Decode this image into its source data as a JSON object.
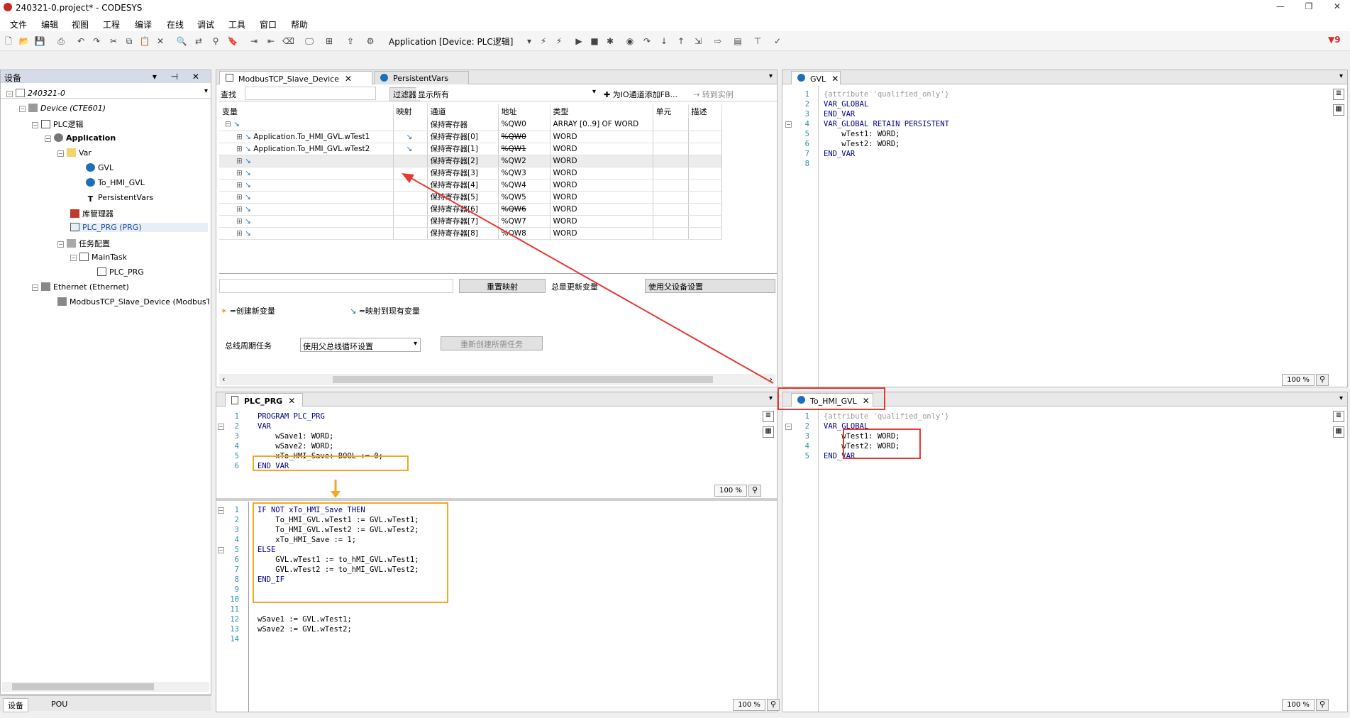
{
  "title": "240321-0.project* - CODESYS",
  "error_count": "9",
  "menu": [
    "文件",
    "编辑",
    "视图",
    "工程",
    "编译",
    "在线",
    "调试",
    "工具",
    "窗口",
    "帮助"
  ],
  "toolbar": {
    "app_selector": "Application [Device: PLC逻辑]"
  },
  "device_panel": {
    "title": "设备",
    "bottom_tabs": [
      "设备",
      "POU"
    ],
    "tree": [
      "240321-0",
      "Device (CTE601)",
      "PLC逻辑",
      "Application",
      "Var",
      "GVL",
      "To_HMI_GVL",
      "PersistentVars",
      "库管理器",
      "PLC_PRG (PRG)",
      "任务配置",
      "MainTask",
      "PLC_PRG",
      "Ethernet (Ethernet)",
      "ModbusTCP_Slave_Device (ModbusTCP S"
    ]
  },
  "top_editor": {
    "tabs": [
      "ModbusTCP_Slave_Device",
      "PersistentVars"
    ],
    "search_label": "查找",
    "filter_label": "过滤器",
    "filter_value": "显示所有",
    "add_fb_label": "为IO通道添加FB...",
    "goto_instance_label": "转到实例",
    "columns": [
      "变量",
      "映射",
      "通道",
      "地址",
      "类型",
      "单元",
      "描述"
    ],
    "rows": [
      {
        "var": "",
        "channel": "保持寄存器",
        "addr": "%QW0",
        "type": "ARRAY [0..9] OF WORD"
      },
      {
        "var": "Application.To_HMI_GVL.wTest1",
        "channel": "保持寄存器[0]",
        "addr": "%QW0",
        "type": "WORD"
      },
      {
        "var": "Application.To_HMI_GVL.wTest2",
        "channel": "保持寄存器[1]",
        "addr": "%QW1",
        "type": "WORD"
      },
      {
        "var": "",
        "channel": "保持寄存器[2]",
        "addr": "%QW2",
        "type": "WORD"
      },
      {
        "var": "",
        "channel": "保持寄存器[3]",
        "addr": "%QW3",
        "type": "WORD"
      },
      {
        "var": "",
        "channel": "保持寄存器[4]",
        "addr": "%QW4",
        "type": "WORD"
      },
      {
        "var": "",
        "channel": "保持寄存器[5]",
        "addr": "%QW5",
        "type": "WORD"
      },
      {
        "var": "",
        "channel": "保持寄存器[6]",
        "addr": "%QW6",
        "type": "WORD"
      },
      {
        "var": "",
        "channel": "保持寄存器[7]",
        "addr": "%QW7",
        "type": "WORD"
      },
      {
        "var": "",
        "channel": "保持寄存器[8]",
        "addr": "%QW8",
        "type": "WORD"
      }
    ],
    "reset_mapping": "重置映射",
    "always_update": "总是更新变量",
    "use_parent": "使用父设备设置",
    "legend_new": "=创建新变量",
    "legend_map": "=映射到现有变量",
    "bus_cycle_label": "总线周期任务",
    "bus_cycle_value": "使用父总线循环设置",
    "recreate_task": "重新创建所需任务"
  },
  "plc_prg": {
    "tab": "PLC_PRG",
    "decl_lines": [
      "PROGRAM PLC_PRG",
      "VAR",
      "    wSave1: WORD;",
      "    wSave2: WORD;",
      "    xTo_HMI_Save: BOOL := 0;",
      "END_VAR"
    ],
    "impl_lines": [
      "IF NOT xTo_HMI_Save THEN",
      "    To_HMI_GVL.wTest1 := GVL.wTest1;",
      "    To_HMI_GVL.wTest2 := GVL.wTest2;",
      "    xTo_HMI_Save := 1;",
      "ELSE",
      "    GVL.wTest1 := to_hMI_GVL.wTest1;",
      "    GVL.wTest2 := to_hMI_GVL.wTest2;",
      "END_IF",
      "",
      "",
      "",
      "wSave1 := GVL.wTest1;",
      "wSave2 := GVL.wTest2;",
      ""
    ]
  },
  "gvl": {
    "tab": "GVL",
    "lines": [
      "{attribute 'qualified_only'}",
      "VAR_GLOBAL",
      "END_VAR",
      "VAR_GLOBAL RETAIN PERSISTENT",
      "    wTest1: WORD;",
      "    wTest2: WORD;",
      "END_VAR",
      ""
    ]
  },
  "to_hmi_gvl": {
    "tab": "To_HMI_GVL",
    "lines": [
      "{attribute 'qualified_only'}",
      "VAR_GLOBAL",
      "    wTest1: WORD;",
      "    wTest2: WORD;",
      "END_VAR"
    ]
  },
  "zoom": "100 %",
  "colors": {
    "annotation_red": "#e53935",
    "annotation_orange": "#f5a623",
    "keyword": "#00008b"
  }
}
